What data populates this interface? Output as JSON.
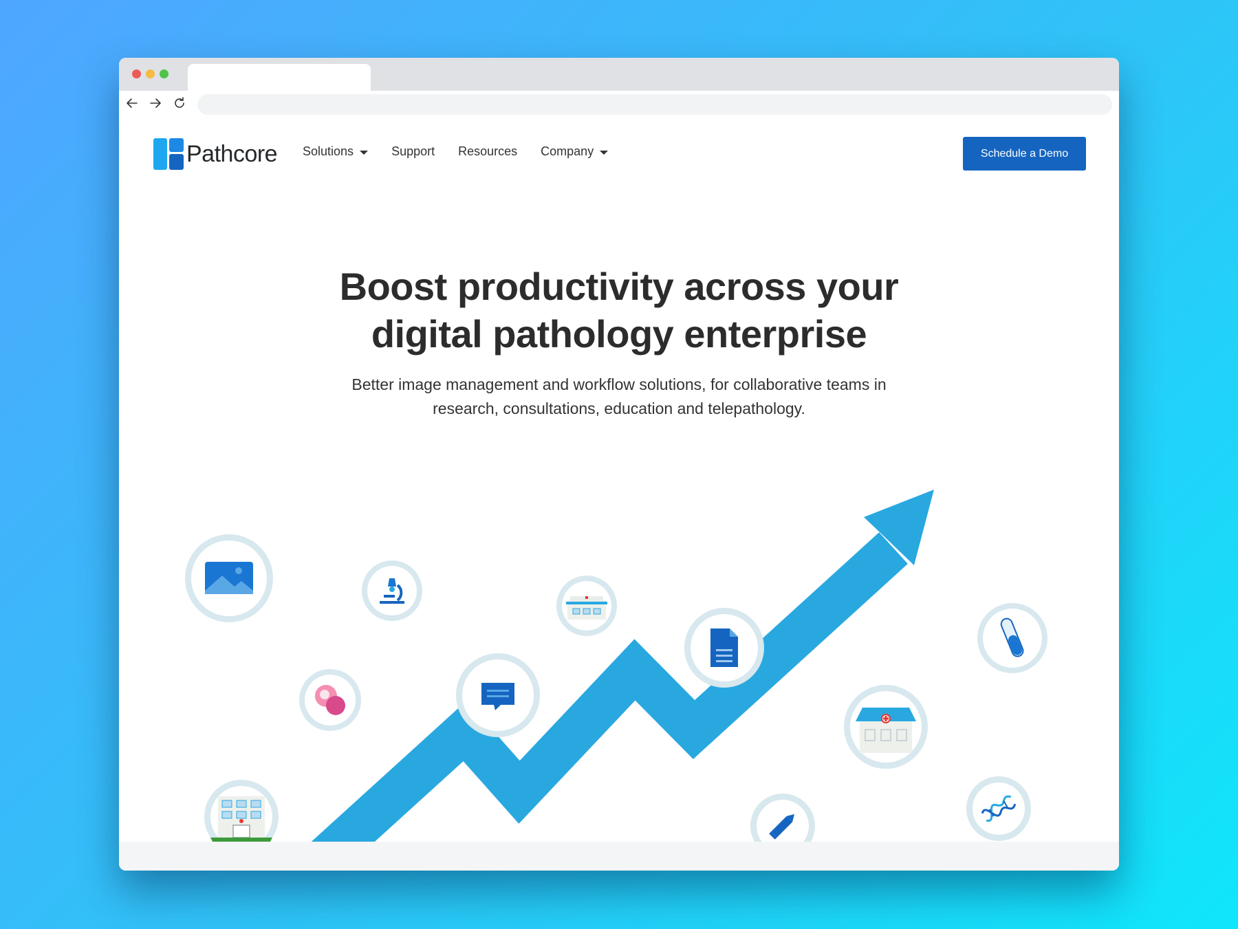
{
  "browser": {
    "traffic_lights": {
      "close": "#ed5b55",
      "minimize": "#f6bc3f",
      "maximize": "#4fc447"
    }
  },
  "header": {
    "logo_text": "Pathcore",
    "nav": [
      {
        "label": "Solutions",
        "has_dropdown": true
      },
      {
        "label": "Support",
        "has_dropdown": false
      },
      {
        "label": "Resources",
        "has_dropdown": false
      },
      {
        "label": "Company",
        "has_dropdown": true
      }
    ],
    "cta_label": "Schedule a Demo"
  },
  "hero": {
    "title_line1": "Boost productivity across your",
    "title_line2": "digital pathology enterprise",
    "subtitle_line1": "Better image management and workflow solutions, for collaborative teams in",
    "subtitle_line2": "research, consultations, education and telepathology."
  },
  "illustration": {
    "icons": [
      "image-icon",
      "microscope-icon",
      "hospital-icon",
      "document-icon",
      "test-tube-icon",
      "cell-icon",
      "chat-icon",
      "clinic-icon",
      "lab-building-icon",
      "pencil-icon",
      "dna-icon"
    ],
    "arrow": "growth-arrow"
  },
  "colors": {
    "brand_blue": "#1565c0",
    "logo_light": "#1ea7f0",
    "arrow_blue": "#29a8e0",
    "circle_ring": "#d7e8ee"
  }
}
